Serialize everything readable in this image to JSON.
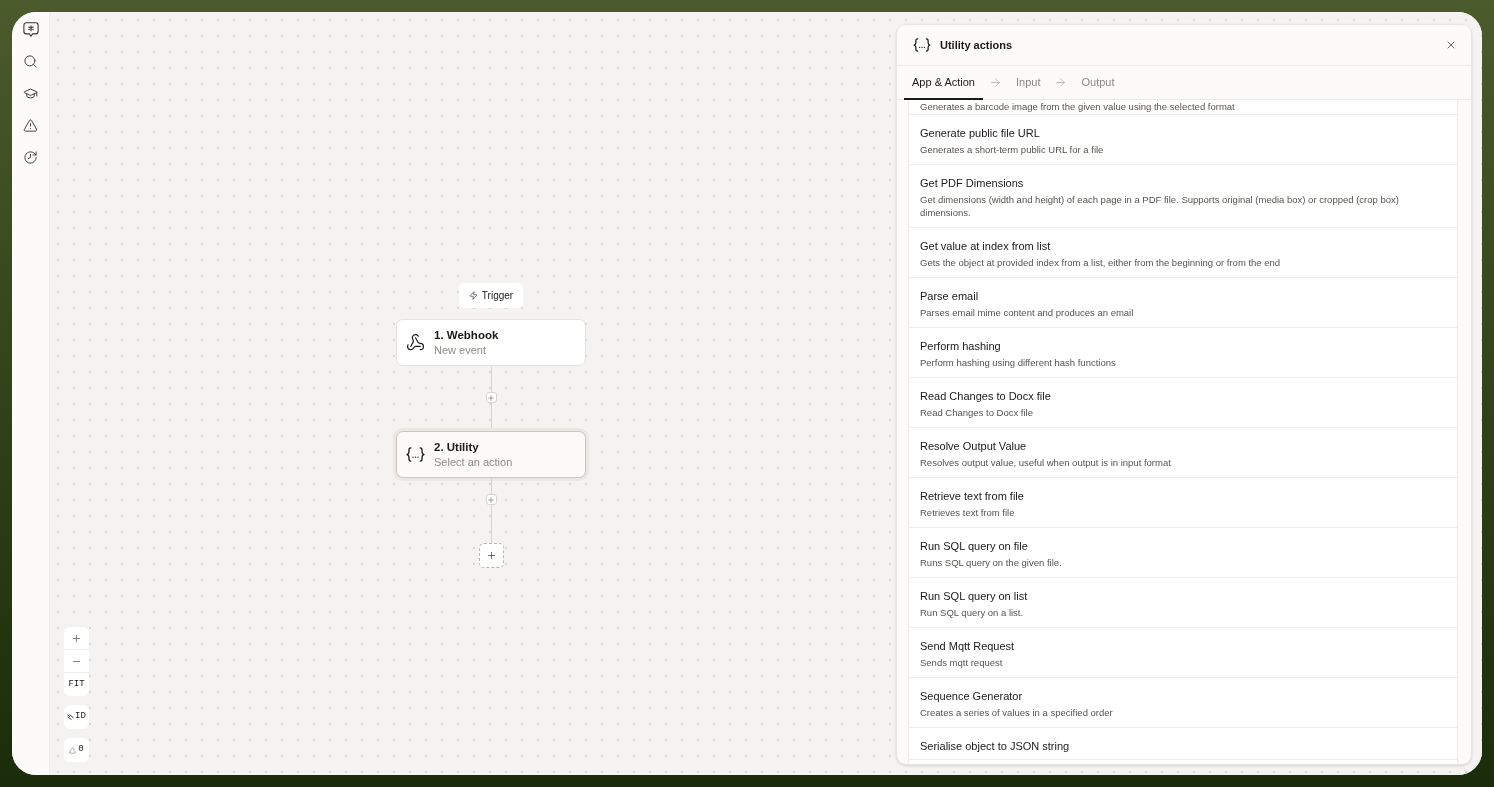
{
  "canvas": {
    "trigger": {
      "label": "Trigger"
    },
    "nodes": [
      {
        "kind": "webhook",
        "title": "1. Webhook",
        "subtitle": "New event",
        "selected": false
      },
      {
        "kind": "utility",
        "title": "2. Utility",
        "subtitle": "Select an action",
        "selected": true
      }
    ]
  },
  "canvas_controls": {
    "fit_label": "FIT",
    "id_label": "ID",
    "warning_count": "0"
  },
  "panel": {
    "title": "Utility actions",
    "tabs": [
      {
        "label": "App & Action",
        "selected": true
      },
      {
        "label": "Input",
        "selected": false
      },
      {
        "label": "Output",
        "selected": false
      }
    ],
    "actions": [
      {
        "description": "Generates a barcode image from the given value using the selected format"
      },
      {
        "title": "Generate public file URL",
        "description": "Generates a short-term public URL for a file"
      },
      {
        "title": "Get PDF Dimensions",
        "description": "Get dimensions (width and height) of each page in a PDF file. Supports original (media box) or cropped (crop box) dimensions."
      },
      {
        "title": "Get value at index from list",
        "description": "Gets the object at provided index from a list, either from the beginning or from the end"
      },
      {
        "title": "Parse email",
        "description": "Parses email mime content and produces an email"
      },
      {
        "title": "Perform hashing",
        "description": "Perform hashing using different hash functions"
      },
      {
        "title": "Read Changes to Docx file",
        "description": "Read Changes to Docx file"
      },
      {
        "title": "Resolve Output Value",
        "description": "Resolves output value, useful when output is in input format"
      },
      {
        "title": "Retrieve text from file",
        "description": "Retrieves text from file"
      },
      {
        "title": "Run SQL query on file",
        "description": "Runs SQL query on the given file."
      },
      {
        "title": "Run SQL query on list",
        "description": "Run SQL query on a list."
      },
      {
        "title": "Send Mqtt Request",
        "description": "Sends mqtt request"
      },
      {
        "title": "Sequence Generator",
        "description": "Creates a series of values in a specified order"
      },
      {
        "title": "Serialise object to JSON string"
      }
    ]
  }
}
